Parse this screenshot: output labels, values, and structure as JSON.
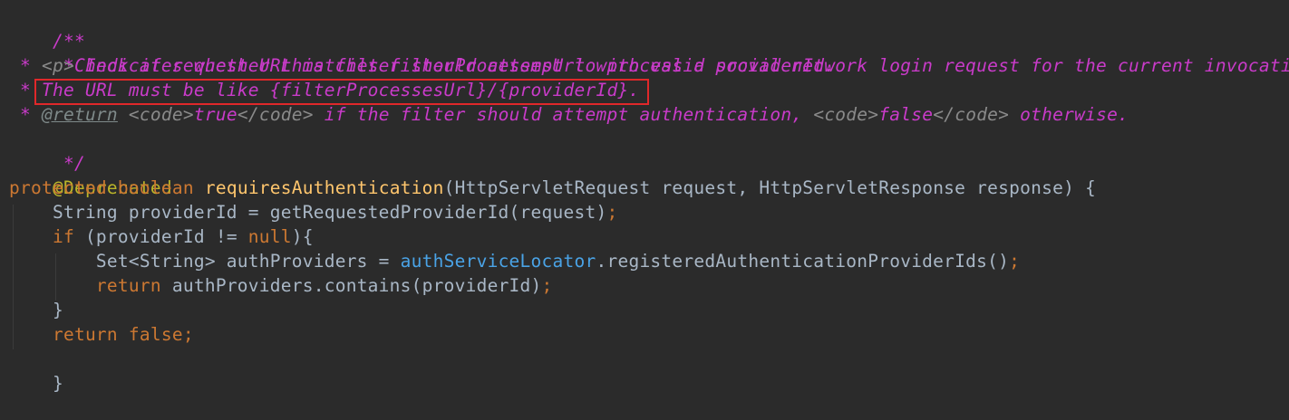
{
  "colors": {
    "background": "#2b2b2b",
    "doc_comment": "#c93bc9",
    "doc_tag": "#8a8a8a",
    "keyword": "#cc7832",
    "method_name": "#ffc66d",
    "annotation": "#bbb529",
    "field": "#4aa3e6",
    "plain": "#a9b7c6",
    "highlight_border": "#e0282a"
  },
  "code": {
    "l1": {
      "c": "/**"
    },
    "l2": {
      "c": " * Indicates whether this filter should attempt to process a social network login request for the current invocation."
    },
    "l3": {
      "a": " * ",
      "b": "<p>",
      "c": "Check if request URL matches filterProcessesUrl with valid providerId."
    },
    "l4": {
      "a": " * ",
      "c": "The URL must be like {filterProcessesUrl}/{providerId}."
    },
    "l5": {
      "a": " * ",
      "tag": "@return",
      "sp1": " ",
      "code_open1": "<code>",
      "t1": "true",
      "code_close1": "</code>",
      "t2": " if the filter should attempt authentication, ",
      "code_open2": "<code>",
      "t3": "false",
      "code_close2": "</code>",
      "t4": " otherwise."
    },
    "l6": {
      "c": " */"
    },
    "l7": {
      "c": "@Deprecated"
    },
    "l8": {
      "kw1": "protected",
      "sp1": " ",
      "kw2": "boolean",
      "sp2": " ",
      "fn": "requiresAuthentication",
      "rest": "(HttpServletRequest request, HttpServletResponse response) {"
    },
    "l9": {
      "indent": "    ",
      "body": "String providerId = getRequestedProviderId(request)",
      "semi": ";"
    },
    "l10": {
      "indent": "    ",
      "kw": "if",
      "p1": " (providerId != ",
      "kw2": "null",
      "p2": "){"
    },
    "l11": {
      "indent": "        ",
      "p1": "Set<String> authProviders = ",
      "field": "authServiceLocator",
      "p2": ".registeredAuthenticationProviderIds()",
      "semi": ";"
    },
    "l12": {
      "indent": "        ",
      "kw": "return",
      "p1": " authProviders.contains(providerId)",
      "semi": ";"
    },
    "l13": {
      "indent": "    ",
      "c": "}"
    },
    "l14": {
      "indent": "    ",
      "kw": "return",
      "sp": " ",
      "kw2": "false",
      "semi": ";"
    },
    "l15": {
      "c": "}"
    }
  }
}
